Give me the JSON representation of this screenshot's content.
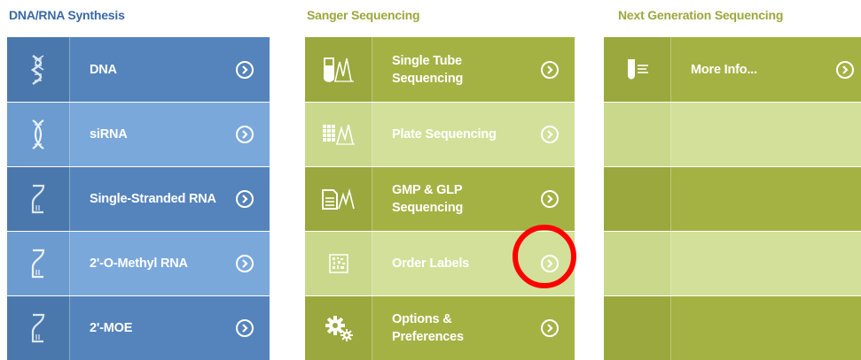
{
  "colors": {
    "dna_title": "#3a68a8",
    "green_title": "#9aa83d",
    "white": "#ffffff",
    "highlight": "#ff0000"
  },
  "dna_column": {
    "title": "DNA/RNA Synthesis",
    "rows": [
      {
        "label": "DNA",
        "icon": "dna-helix-icon",
        "shade": "dark"
      },
      {
        "label": "siRNA",
        "icon": "double-helix-icon",
        "shade": "light"
      },
      {
        "label": "Single-Stranded RNA",
        "icon": "single-strand-icon",
        "shade": "dark"
      },
      {
        "label": "2'-O-Methyl RNA",
        "icon": "single-strand-icon",
        "shade": "light"
      },
      {
        "label": "2'-MOE",
        "icon": "single-strand-icon",
        "shade": "dark"
      }
    ]
  },
  "sanger_column": {
    "title": "Sanger Sequencing",
    "rows": [
      {
        "label": "Single Tube Sequencing",
        "icon": "tube-peaks-icon",
        "shade": "dark"
      },
      {
        "label": "Plate Sequencing",
        "icon": "plate-peaks-icon",
        "shade": "light"
      },
      {
        "label": "GMP & GLP Sequencing",
        "icon": "document-peaks-icon",
        "shade": "dark"
      },
      {
        "label": "Order Labels",
        "icon": "barcode-label-icon",
        "shade": "light"
      },
      {
        "label": "Options & Preferences",
        "icon": "gears-icon",
        "shade": "dark"
      }
    ]
  },
  "ngs_column": {
    "title": "Next Generation Sequencing",
    "rows": [
      {
        "label": "More Info...",
        "icon": "tube-list-icon",
        "shade": "dark"
      },
      {
        "label": "",
        "shade": "light"
      },
      {
        "label": "",
        "shade": "dark"
      },
      {
        "label": "",
        "shade": "light"
      },
      {
        "label": "",
        "shade": "dark"
      }
    ]
  }
}
